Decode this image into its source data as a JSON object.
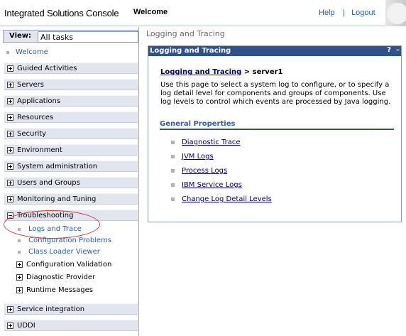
{
  "header": {
    "app_title": "Integrated Solutions Console",
    "page_name": "Welcome",
    "help": "Help",
    "separator": "|",
    "logout": "Logout"
  },
  "nav": {
    "view_label": "View:",
    "view_value": "All tasks",
    "welcome": "Welcome",
    "sections": [
      {
        "label": "Guided Activities",
        "expanded": false
      },
      {
        "label": "Servers",
        "expanded": false
      },
      {
        "label": "Applications",
        "expanded": false
      },
      {
        "label": "Resources",
        "expanded": false
      },
      {
        "label": "Security",
        "expanded": false
      },
      {
        "label": "Environment",
        "expanded": false
      },
      {
        "label": "System administration",
        "expanded": false
      },
      {
        "label": "Users and Groups",
        "expanded": false
      },
      {
        "label": "Monitoring and Tuning",
        "expanded": false
      },
      {
        "label": "Troubleshooting",
        "expanded": true
      },
      {
        "label": "Service integration",
        "expanded": false
      },
      {
        "label": "UDDI",
        "expanded": false
      }
    ],
    "troubleshooting_items": [
      "Logs and Trace",
      "Configuration Problems",
      "Class Loader Viewer",
      "Configuration Validation",
      "Diagnostic Provider",
      "Runtime Messages"
    ]
  },
  "main": {
    "page_title": "Logging and Tracing",
    "panel_title": "Logging and Tracing",
    "help_glyph": "?",
    "minimize_glyph": "–",
    "breadcrumb_link": "Logging and Tracing",
    "breadcrumb_rest": " > server1",
    "description": "Use this page to select a system log to configure, or to specify a log detail level for components and groups of components. Use log levels to control which events are processed by Java logging.",
    "general_properties_title": "General Properties",
    "properties": [
      "Diagnostic Trace",
      "JVM Logs",
      "Process Logs",
      "IBM Service Logs",
      "Change Log Detail Levels"
    ]
  },
  "colors": {
    "panel_header": "#2f528f",
    "link": "#2a5db0",
    "annotation": "#d23a3a"
  }
}
